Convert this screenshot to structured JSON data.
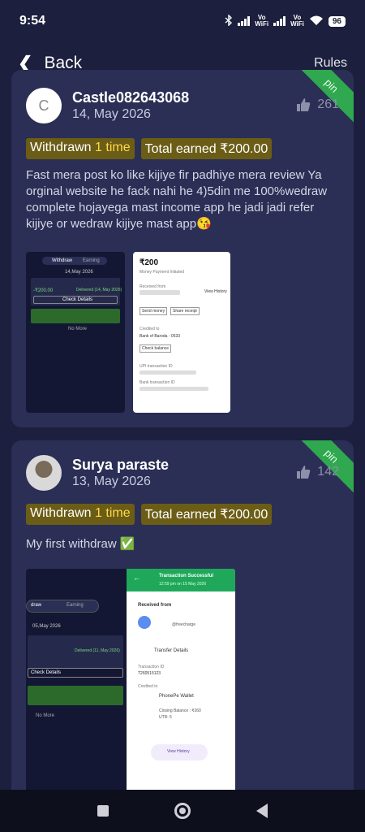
{
  "status": {
    "time": "9:54",
    "vo": "Vo",
    "wifi_label": "WiFi",
    "battery": "96"
  },
  "header": {
    "back_label": "Back",
    "rules_label": "Rules"
  },
  "posts": [
    {
      "avatar_letter": "C",
      "username": "Castle082643068",
      "date": "14, May 2026",
      "likes": "261",
      "pin_label": "pin",
      "withdrawn_prefix": "Withdrawn",
      "withdrawn_count": "1 time",
      "earned_prefix": "Total earned",
      "earned_amount": "₹200.00",
      "text": "Fast mera post ko like kijiye  fir padhiye mera review Ya orginal website he fack nahi he 4)5din me 100%wedraw complete hojayega mast income app he jadi jadi refer kijiye or wedraw kijiye  mast app😘",
      "shot_left": {
        "tab1": "Withdraw",
        "tab2": "Earning",
        "date": "14,May 2026",
        "amount": "-₹200.00",
        "status": "Delivered (14, May 2026)",
        "button": "Check Details",
        "footer": "No More"
      },
      "shot_right": {
        "amount": "₹200",
        "subtitle": "Money Payment Initiated",
        "received_from": "Received from",
        "view_history": "View History",
        "send_money": "Send money",
        "share_receipt": "Share receipt",
        "credited_to": "Credited to",
        "bank": "Bank of Baroda - 0533",
        "check_balance": "Check balance",
        "upi_id": "UPI transaction ID",
        "bank_id": "Bank transaction ID"
      }
    },
    {
      "username": "Surya paraste",
      "date": "13, May 2026",
      "likes": "142",
      "pin_label": "pin",
      "withdrawn_prefix": "Withdrawn",
      "withdrawn_count": "1 time",
      "earned_prefix": "Total earned",
      "earned_amount": "₹200.00",
      "text": "My first withdraw ✅",
      "shot_left": {
        "tab1": "draw",
        "tab2": "Earning",
        "date": "05,May 2026",
        "status": "Delivered (11, May 2026)",
        "button": "Check Details",
        "footer": "No More"
      },
      "shot_right": {
        "title": "Transaction Successful",
        "subtitle": "12:59 pm on 15 May 2026",
        "received_from": "Received from",
        "handle": "@freecharge",
        "transfer_details": "Transfer Details",
        "txn_label": "Transaction ID",
        "txn_value": "T260515123",
        "credited_to": "Credited to",
        "wallet": "PhonePe Wallet",
        "closing": "Closing Balance : ₹260",
        "utr": "UTR: 5",
        "view_history": "View History"
      }
    }
  ]
}
